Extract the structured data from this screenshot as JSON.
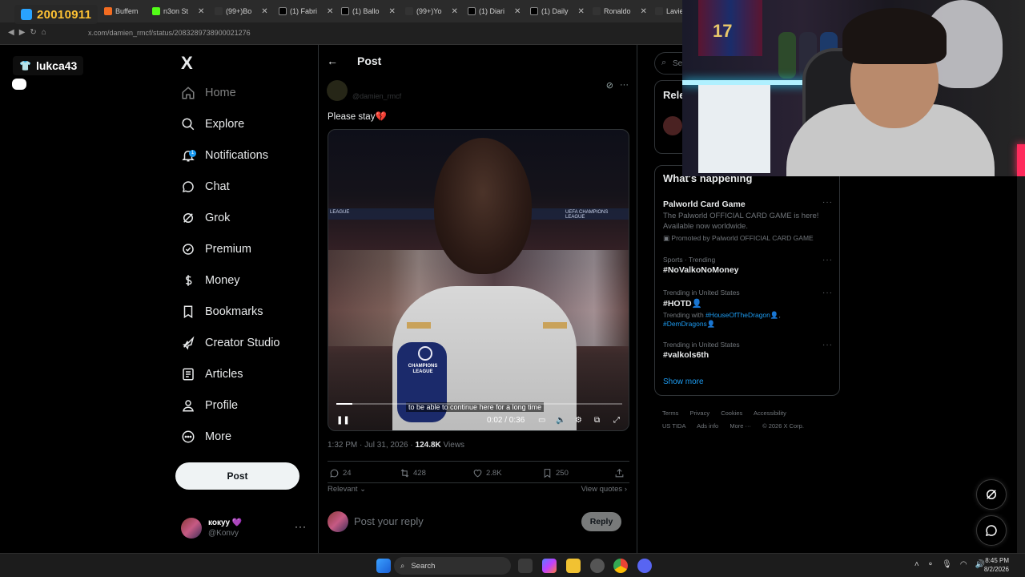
{
  "browser": {
    "tabs": [
      {
        "label": "Buffem",
        "color": "#f36c21"
      },
      {
        "label": "n3on St",
        "color": "#53fc18"
      },
      {
        "label": "(99+)Bo",
        "color": "#ffffff"
      },
      {
        "label": "(1) Fabri",
        "color": "#ffffff"
      },
      {
        "label": "(1) Ballo",
        "color": "#ffffff"
      },
      {
        "label": "(99+)Yo",
        "color": "#ffffff"
      },
      {
        "label": "(1) Diari",
        "color": "#ffffff"
      },
      {
        "label": "(1) Daily",
        "color": "#ffffff"
      },
      {
        "label": "Ronaldo",
        "color": "#ffffff"
      },
      {
        "label": "Lavie",
        "color": "#ffffff"
      }
    ],
    "url": "x.com/damien_rmcf/status/2083289738900021276"
  },
  "overlay": {
    "counter": "20010911",
    "username": "lukca43"
  },
  "sidebar": {
    "logo": "X",
    "items": [
      {
        "label": "Home",
        "icon": "home-icon"
      },
      {
        "label": "Explore",
        "icon": "search-icon"
      },
      {
        "label": "Notifications",
        "icon": "bell-icon",
        "badge": "1"
      },
      {
        "label": "Chat",
        "icon": "chat-icon"
      },
      {
        "label": "Grok",
        "icon": "grok-icon"
      },
      {
        "label": "Premium",
        "icon": "premium-icon"
      },
      {
        "label": "Money",
        "icon": "money-icon"
      },
      {
        "label": "Bookmarks",
        "icon": "bookmark-icon"
      },
      {
        "label": "Creator Studio",
        "icon": "rocket-icon"
      },
      {
        "label": "Articles",
        "icon": "article-icon"
      },
      {
        "label": "Profile",
        "icon": "profile-icon"
      },
      {
        "label": "More",
        "icon": "more-circle-icon"
      }
    ],
    "post_label": "Post",
    "account": {
      "display_name": "кокуу 💜",
      "handle": "@Konvy"
    }
  },
  "main": {
    "back": "←",
    "title": "Post",
    "author_handle": "@damien_rmcf",
    "text": "Please stay💔",
    "video": {
      "subtitle": "to be able to continue here for a long time",
      "time": "0:02 / 0:36",
      "progress": 0.056,
      "banner_text": "UEFA CHAMPIONS LEAGUE",
      "banner_text_left": "LEAGUE",
      "mic_label": "CHAMPIONS LEAGUE"
    },
    "meta": {
      "time": "1:32 PM · Jul 31, 2026 · ",
      "views": "124.8K",
      "views_label": " Views"
    },
    "actions": {
      "replies": "24",
      "reposts": "428",
      "likes": "2.8K",
      "bookmarks": "250"
    },
    "relevant": "Relevant",
    "view_quotes": "View quotes",
    "reply_placeholder": "Post your reply",
    "reply_label": "Reply"
  },
  "right": {
    "search_placeholder": "Se",
    "relevant_title": "Rele",
    "happening_title": "What's happening",
    "trends": [
      {
        "category": "",
        "name": "Palworld Card Game",
        "desc": "The Palworld OFFICIAL CARD GAME is here! Available now worldwide.",
        "promo": "Promoted by Palworld OFFICIAL CARD GAME"
      },
      {
        "category": "Sports · Trending",
        "name": "#NoValkoNoMoney"
      },
      {
        "category": "Trending in United States",
        "name": "#HOTD👤",
        "with_label": "Trending with ",
        "with_a": "#HouseOfTheDragon",
        "with_b": "#DemDragons"
      },
      {
        "category": "Trending in United States",
        "name": "#valkols6th"
      }
    ],
    "show_more": "Show more",
    "footer": [
      "Terms",
      "Privacy",
      "Cookies",
      "Accessibility",
      "US TIDA",
      "Ads info",
      "More ···",
      "© 2026 X Corp."
    ]
  },
  "webcam": {
    "jersey_number": "17"
  },
  "taskbar": {
    "search": "Search",
    "time": "8:45 PM",
    "date": "8/2/2026"
  }
}
